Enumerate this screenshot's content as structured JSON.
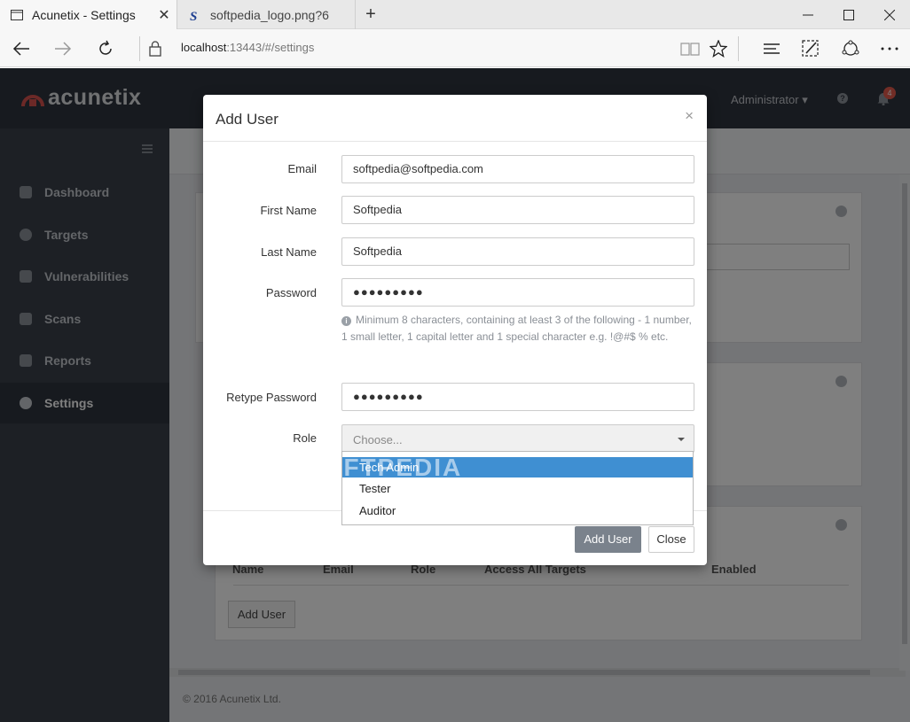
{
  "browser": {
    "tabs": [
      {
        "title": "Acunetix - Settings",
        "active": true
      },
      {
        "title": "softpedia_logo.png?6",
        "active": false
      }
    ],
    "url_host": "localhost",
    "url_rest": ":13443/#/settings"
  },
  "app": {
    "logo": "acunetix",
    "user_menu": "Administrator",
    "notifications_count": "4",
    "sidebar": [
      {
        "label": "Dashboard",
        "icon": "dashboard-icon"
      },
      {
        "label": "Targets",
        "icon": "target-icon"
      },
      {
        "label": "Vulnerabilities",
        "icon": "bug-icon"
      },
      {
        "label": "Scans",
        "icon": "chart-icon"
      },
      {
        "label": "Reports",
        "icon": "document-icon"
      },
      {
        "label": "Settings",
        "icon": "gear-icon",
        "active": true
      }
    ],
    "users_table_headers": [
      "Name",
      "Email",
      "Role",
      "Access All Targets",
      "Enabled"
    ],
    "add_user_bg_button": "Add User",
    "footer": "© 2016 Acunetix Ltd."
  },
  "modal": {
    "title": "Add User",
    "close_symbol": "×",
    "fields": {
      "email": {
        "label": "Email",
        "value": "softpedia@softpedia.com"
      },
      "first_name": {
        "label": "First Name",
        "value": "Softpedia"
      },
      "last_name": {
        "label": "Last Name",
        "value": "Softpedia"
      },
      "password": {
        "label": "Password",
        "value": "●●●●●●●●●"
      },
      "retype_password": {
        "label": "Retype Password",
        "value": "●●●●●●●●●"
      },
      "role": {
        "label": "Role",
        "placeholder": "Choose..."
      }
    },
    "password_hint": "Minimum 8 characters, containing at least 3 of the following - 1 number, 1 small letter, 1 capital letter and 1 special character e.g. !@#$ % etc.",
    "role_options": [
      "Tech Admin",
      "Tester",
      "Auditor"
    ],
    "selected_role_option": "Tech Admin",
    "buttons": {
      "add_user": "Add User",
      "close": "Close"
    }
  },
  "watermark": "SOFTPEDIA",
  "colors": {
    "accent": "#3f8fd2",
    "primary_button": "#7a828c",
    "topbar": "#2f353e",
    "sidebar": "#3a414a",
    "logo_mark": "#d9534f"
  }
}
